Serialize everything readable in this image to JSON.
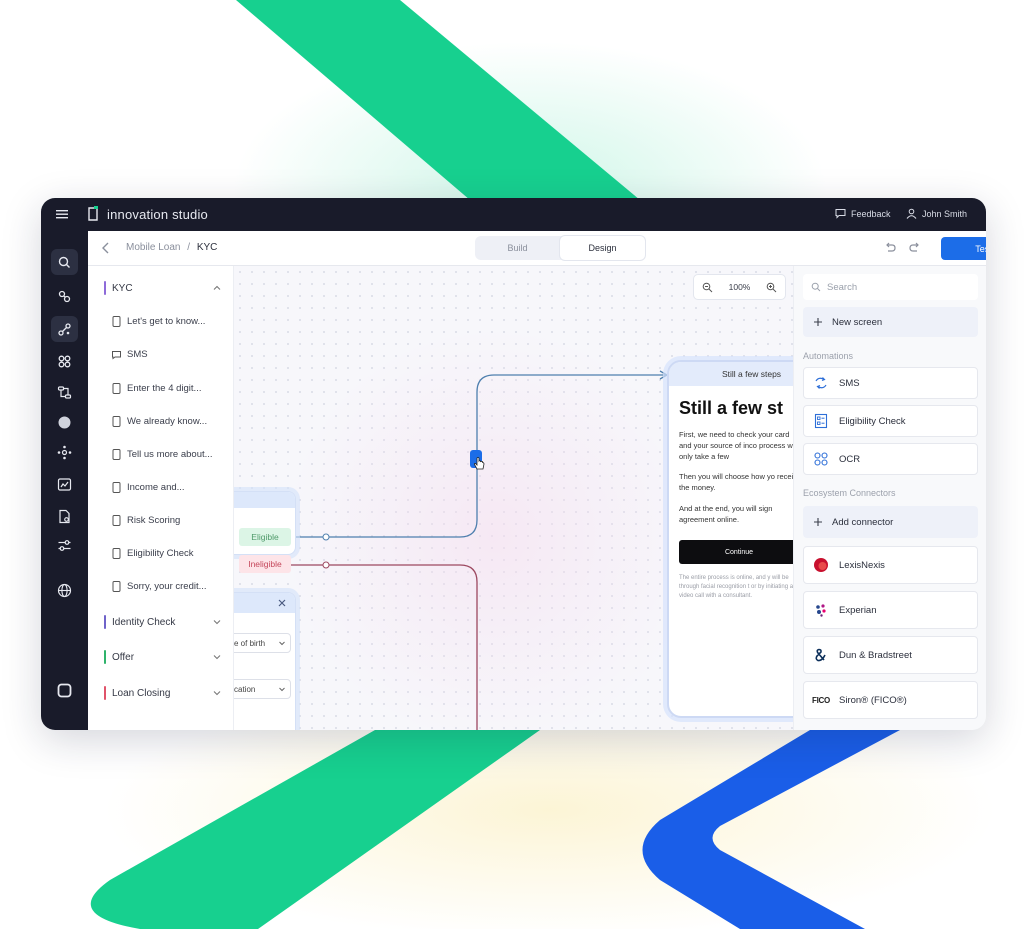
{
  "topbar": {
    "app_title": "innovation studio",
    "feedback_label": "Feedback",
    "user_name": "John Smith"
  },
  "subheader": {
    "breadcrumb_parent": "Mobile Loan",
    "breadcrumb_separator": "/",
    "breadcrumb_current": "KYC",
    "tabs": [
      {
        "label": "Build",
        "active": false
      },
      {
        "label": "Design",
        "active": true
      }
    ],
    "test_label": "Test"
  },
  "screen_list": {
    "groups": [
      {
        "label": "KYC",
        "color": "#8e6bd9",
        "expanded": true
      },
      {
        "label": "Identity Check",
        "color": "#6f63c9",
        "expanded": false
      },
      {
        "label": "Offer",
        "color": "#2fb36b",
        "expanded": false
      },
      {
        "label": "Loan Closing",
        "color": "#e0536a",
        "expanded": false
      }
    ],
    "items": [
      {
        "label": "Let's get to know...",
        "icon": "phone-icon"
      },
      {
        "label": "SMS",
        "icon": "message-icon"
      },
      {
        "label": "Enter the 4 digit...",
        "icon": "phone-icon"
      },
      {
        "label": "We already know...",
        "icon": "phone-icon"
      },
      {
        "label": "Tell us more about...",
        "icon": "phone-icon"
      },
      {
        "label": "Income and...",
        "icon": "phone-icon"
      },
      {
        "label": "Risk Scoring",
        "icon": "phone-icon"
      },
      {
        "label": "Eligibility Check",
        "icon": "phone-icon"
      },
      {
        "label": "Sorry, your credit...",
        "icon": "phone-icon"
      }
    ]
  },
  "canvas": {
    "zoom_value": "100%",
    "outcomes": {
      "eligible": "Eligible",
      "ineligible": "Ineligible"
    },
    "form_fields": [
      "e of birth",
      "cation"
    ],
    "phone": {
      "header": "Still a few steps",
      "title": "Still a few st",
      "para1": "First, we need to check your card and your source of inco process will only take a few",
      "para2": "Then you will choose how yo receive the money.",
      "para3": "And at the end, you will sign agreement online.",
      "cta": "Continue",
      "fine_print": "The entire process is online, and y will be through facial recognition t or by initiating a video call with a consultant."
    }
  },
  "right_panel": {
    "search_placeholder": "Search",
    "new_screen_label": "New screen",
    "automations_label": "Automations",
    "automations": [
      {
        "label": "SMS",
        "icon": "sync-icon"
      },
      {
        "label": "Eligibility Check",
        "icon": "checklist-icon"
      },
      {
        "label": "OCR",
        "icon": "scan-icon"
      }
    ],
    "connectors_label": "Ecosystem Connectors",
    "add_connector_label": "Add connector",
    "connectors": [
      {
        "label": "LexisNexis",
        "icon": "lexisnexis-logo"
      },
      {
        "label": "Experian",
        "icon": "experian-logo"
      },
      {
        "label": "Dun & Bradstreet",
        "icon": "dnb-logo"
      },
      {
        "label": "Siron® (FICO®)",
        "icon": "fico-logo",
        "logo_text": "FICO"
      }
    ]
  },
  "colors": {
    "accent": "#1c6de8",
    "topbar": "#191b2a",
    "eligible": "#2fb36b",
    "ineligible": "#c5475b",
    "deco_green": "#17d08f",
    "deco_blue": "#1a5ee8"
  }
}
